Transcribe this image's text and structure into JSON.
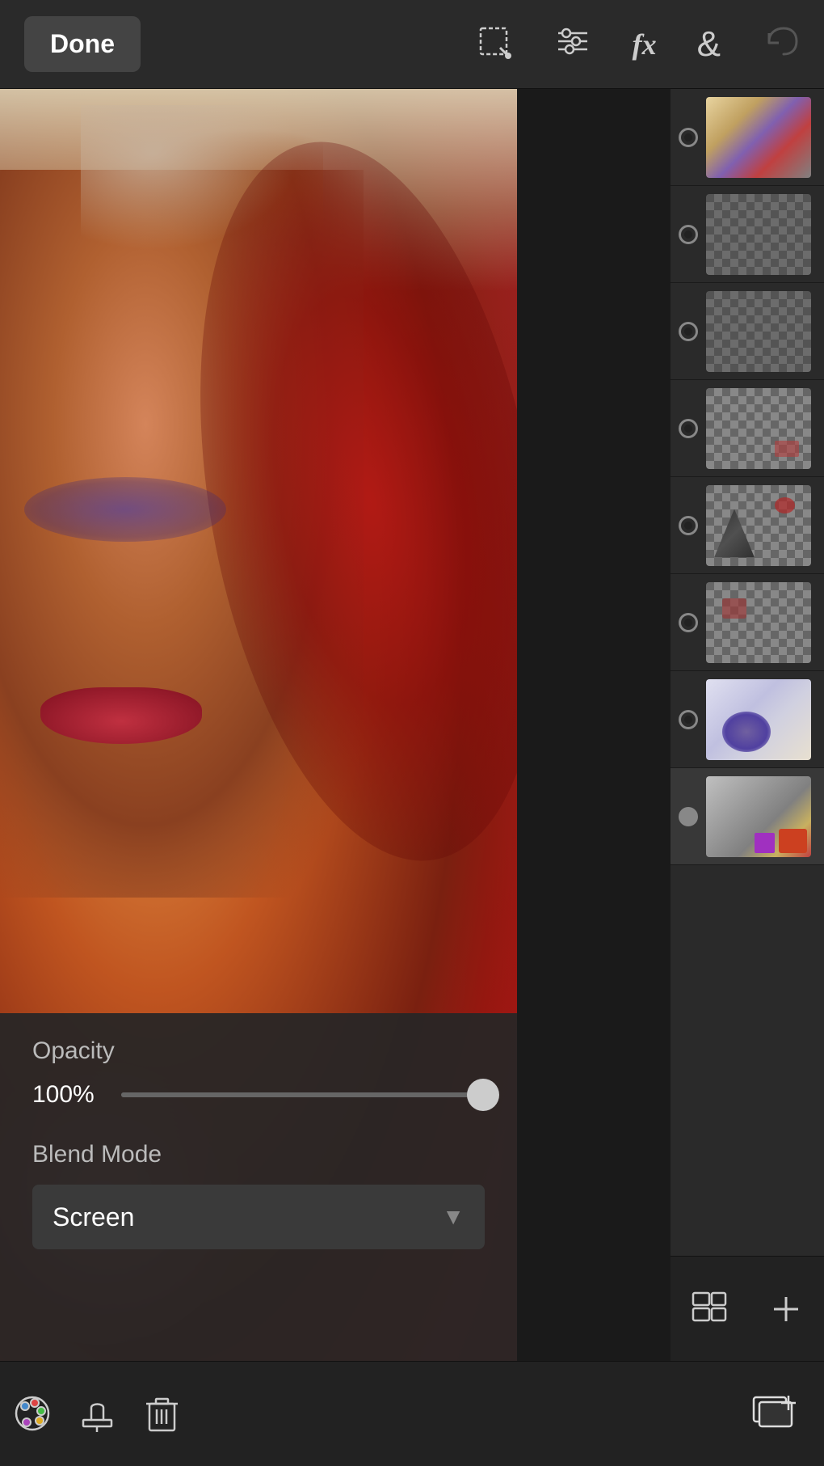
{
  "toolbar": {
    "done_label": "Done",
    "icons": [
      {
        "name": "select-tool-icon",
        "symbol": "⬚✏"
      },
      {
        "name": "adjustments-icon",
        "symbol": "⇌"
      },
      {
        "name": "fx-icon",
        "symbol": "fx"
      },
      {
        "name": "blend-icon",
        "symbol": "&"
      },
      {
        "name": "undo-icon",
        "symbol": "↩"
      }
    ]
  },
  "layers": [
    {
      "id": 1,
      "selected": false,
      "thumb_class": "layer-thumb-1",
      "visible": true
    },
    {
      "id": 2,
      "selected": false,
      "thumb_class": "layer-thumb-2",
      "visible": true
    },
    {
      "id": 3,
      "selected": false,
      "thumb_class": "layer-thumb-3",
      "visible": true
    },
    {
      "id": 4,
      "selected": false,
      "thumb_class": "layer-thumb-4",
      "visible": true
    },
    {
      "id": 5,
      "selected": false,
      "thumb_class": "layer-thumb-5",
      "visible": true
    },
    {
      "id": 6,
      "selected": false,
      "thumb_class": "layer-thumb-6",
      "visible": true
    },
    {
      "id": 7,
      "selected": false,
      "thumb_class": "layer-thumb-7",
      "visible": true
    },
    {
      "id": 8,
      "selected": true,
      "thumb_class": "layer-thumb-8",
      "visible": true
    }
  ],
  "controls": {
    "opacity_label": "Opacity",
    "opacity_value": "100%",
    "blend_mode_label": "Blend Mode",
    "blend_mode_value": "Screen"
  },
  "bottom_toolbar": {
    "tools": [
      {
        "name": "paint-tool",
        "label": "🎨"
      },
      {
        "name": "stamp-tool",
        "label": "⬇"
      },
      {
        "name": "delete-tool",
        "label": "🗑"
      },
      {
        "name": "add-layer-tool",
        "label": "⊕"
      }
    ]
  },
  "layers_panel": {
    "layers_icon": "◫",
    "add_icon": "+"
  }
}
